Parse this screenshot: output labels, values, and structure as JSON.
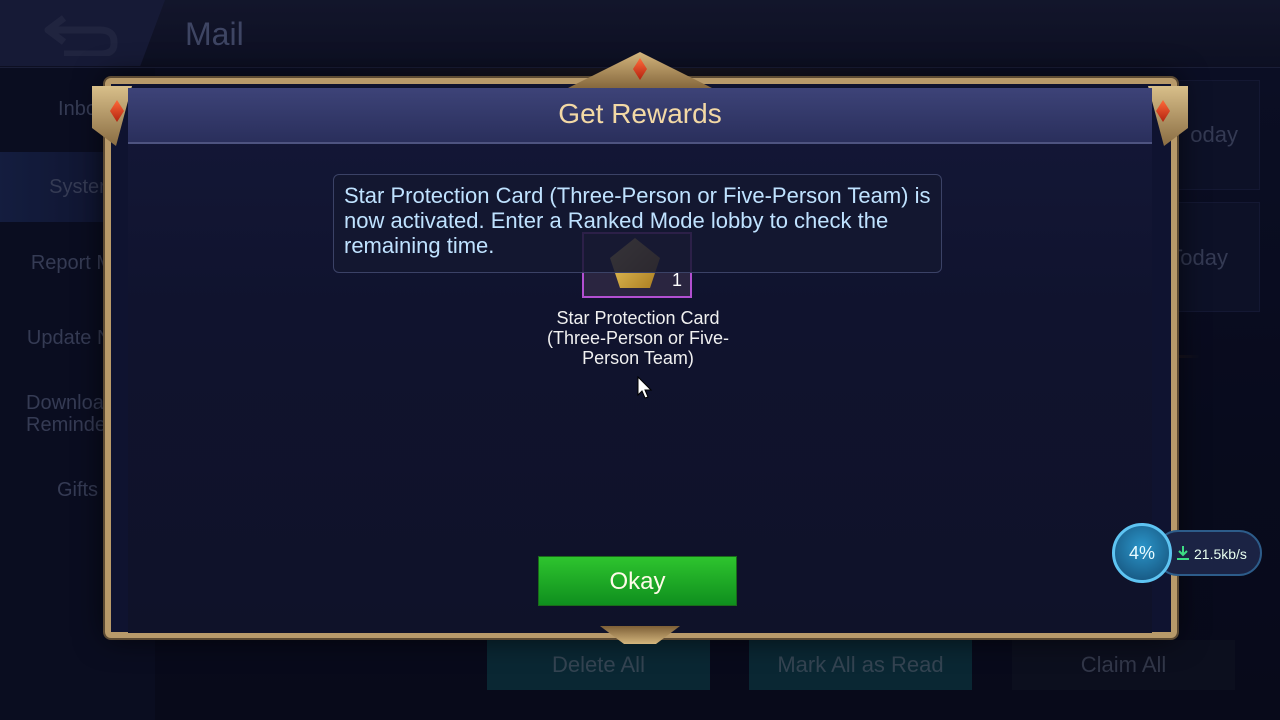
{
  "header": {
    "title": "Mail"
  },
  "sidebar": {
    "items": [
      {
        "label": "Inbo"
      },
      {
        "label": "Syster"
      },
      {
        "label": "Report Ma"
      },
      {
        "label": "Update Not"
      },
      {
        "label": "Download Reminder"
      },
      {
        "label": "Gifts"
      }
    ]
  },
  "list": {
    "dates": [
      "oday",
      "Today"
    ]
  },
  "footer": {
    "delete_all": "Delete All",
    "mark_all_read": "Mark All as Read",
    "claim_all": "Claim All"
  },
  "dialog": {
    "title": "Get Rewards",
    "tooltip": "Star Protection Card (Three-Person or Five-Person Team) is now activated. Enter a Ranked Mode lobby to check the remaining time.",
    "item": {
      "name": "Star Protection Card (Three-Person or Five-Person Team)",
      "quantity": "1"
    },
    "okay_label": "Okay"
  },
  "download": {
    "progress": "4%",
    "speed": "21.5kb/s"
  },
  "colors": {
    "accent_gold": "#f3d9a5",
    "okay_green": "#1fae24",
    "tooltip_text": "#bfe2ff",
    "item_border": "#b24fd1"
  }
}
